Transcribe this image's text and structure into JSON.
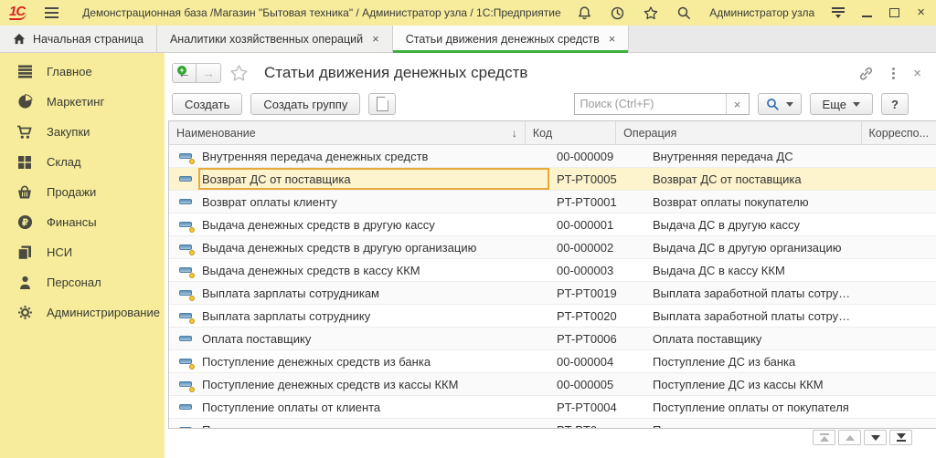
{
  "titlebar": {
    "app_title": "Демонстрационная база /Магазин \"Бытовая техника\" / Администратор узла / 1С:Предприятие",
    "logo": "1С",
    "user_name": "Администратор узла",
    "icons": [
      "notifications-icon",
      "history-icon",
      "favorites-icon",
      "search-icon",
      "service-menu-icon",
      "minimize-icon",
      "maximize-icon",
      "close-icon"
    ]
  },
  "glyphs": {
    "close": "×",
    "back": "←",
    "forward": "→",
    "sort_down": "↓",
    "plus": "+"
  },
  "tabs": [
    {
      "label": "Начальная страница",
      "active": false,
      "closable": false,
      "icon": "home-icon"
    },
    {
      "label": "Аналитики хозяйственных операций",
      "active": false,
      "closable": true
    },
    {
      "label": "Статьи движения денежных средств",
      "active": true,
      "closable": true
    }
  ],
  "sidebar": {
    "items": [
      {
        "label": "Главное",
        "icon": "sections-icon"
      },
      {
        "label": "Маркетинг",
        "icon": "pie-chart-icon"
      },
      {
        "label": "Закупки",
        "icon": "cart-icon"
      },
      {
        "label": "Склад",
        "icon": "grid-icon"
      },
      {
        "label": "Продажи",
        "icon": "basket-icon"
      },
      {
        "label": "Финансы",
        "icon": "ruble-icon"
      },
      {
        "label": "НСИ",
        "icon": "catalog-icon"
      },
      {
        "label": "Персонал",
        "icon": "person-icon"
      },
      {
        "label": "Администрирование",
        "icon": "gear-icon"
      }
    ]
  },
  "panel": {
    "title": "Статьи движения денежных средств",
    "header_icons": [
      "link-icon",
      "more-dots-icon",
      "close-icon"
    ],
    "toolbar": {
      "create": "Создать",
      "create_group": "Создать группу",
      "new_item_icon": "new-document-plus-icon",
      "search_placeholder": "Поиск (Ctrl+F)",
      "search_button_icon": "search-icon",
      "more": "Еще",
      "help": "?"
    },
    "table": {
      "columns": {
        "name": "Наименование",
        "code": "Код",
        "operation": "Операция",
        "correspondence": "Корреспо...",
        "sort_indicator": "↓"
      },
      "rows": [
        {
          "name": "Внутренняя передача денежных средств",
          "code": "00-000009",
          "operation": "Внутренняя передача ДС",
          "predefined": true
        },
        {
          "name": "Возврат ДС от поставщика",
          "code": "PT-PT0005",
          "operation": "Возврат ДС от поставщика",
          "selected": true
        },
        {
          "name": "Возврат оплаты клиенту",
          "code": "PT-PT0001",
          "operation": "Возврат оплаты покупателю"
        },
        {
          "name": "Выдача денежных средств в другую кассу",
          "code": "00-000001",
          "operation": "Выдача ДС в другую кассу",
          "predefined": true
        },
        {
          "name": "Выдача денежных средств в другую организацию",
          "code": "00-000002",
          "operation": "Выдача ДС в другую организацию",
          "predefined": true
        },
        {
          "name": "Выдача денежных средств в кассу ККМ",
          "code": "00-000003",
          "operation": "Выдача ДС в кассу ККМ",
          "predefined": true
        },
        {
          "name": "Выплата зарплаты сотрудникам",
          "code": "PT-PT0019",
          "operation": "Выплата заработной платы сотру…",
          "predefined": true
        },
        {
          "name": "Выплата зарплаты сотруднику",
          "code": "PT-PT0020",
          "operation": "Выплата заработной платы сотру…",
          "predefined": true
        },
        {
          "name": "Оплата поставщику",
          "code": "PT-PT0006",
          "operation": "Оплата поставщику"
        },
        {
          "name": "Поступление денежных средств из банка",
          "code": "00-000004",
          "operation": "Поступление ДС из банка",
          "predefined": true
        },
        {
          "name": "Поступление денежных средств из кассы ККМ",
          "code": "00-000005",
          "operation": "Поступление ДС из кассы ККМ",
          "predefined": true
        },
        {
          "name": "Поступление оплаты от клиента",
          "code": "PT-PT0004",
          "operation": "Поступление оплаты от покупателя"
        },
        {
          "name": "П",
          "code": "PT-PT0",
          "operation": "П",
          "clipped": true
        }
      ]
    },
    "list_nav": [
      "move-to-top-icon",
      "move-up-icon",
      "move-down-icon",
      "move-to-bottom-icon"
    ]
  },
  "colors": {
    "brand_yellow": "#f6ec9c",
    "active_tab_green": "#3bb13b",
    "selected_row_bg": "#fdf3cd",
    "selected_row_border": "#e7a93a",
    "item_icon_blue": "#5e90b8",
    "predefined_dot": "#f3c53a",
    "logo_red": "#d6251f"
  }
}
